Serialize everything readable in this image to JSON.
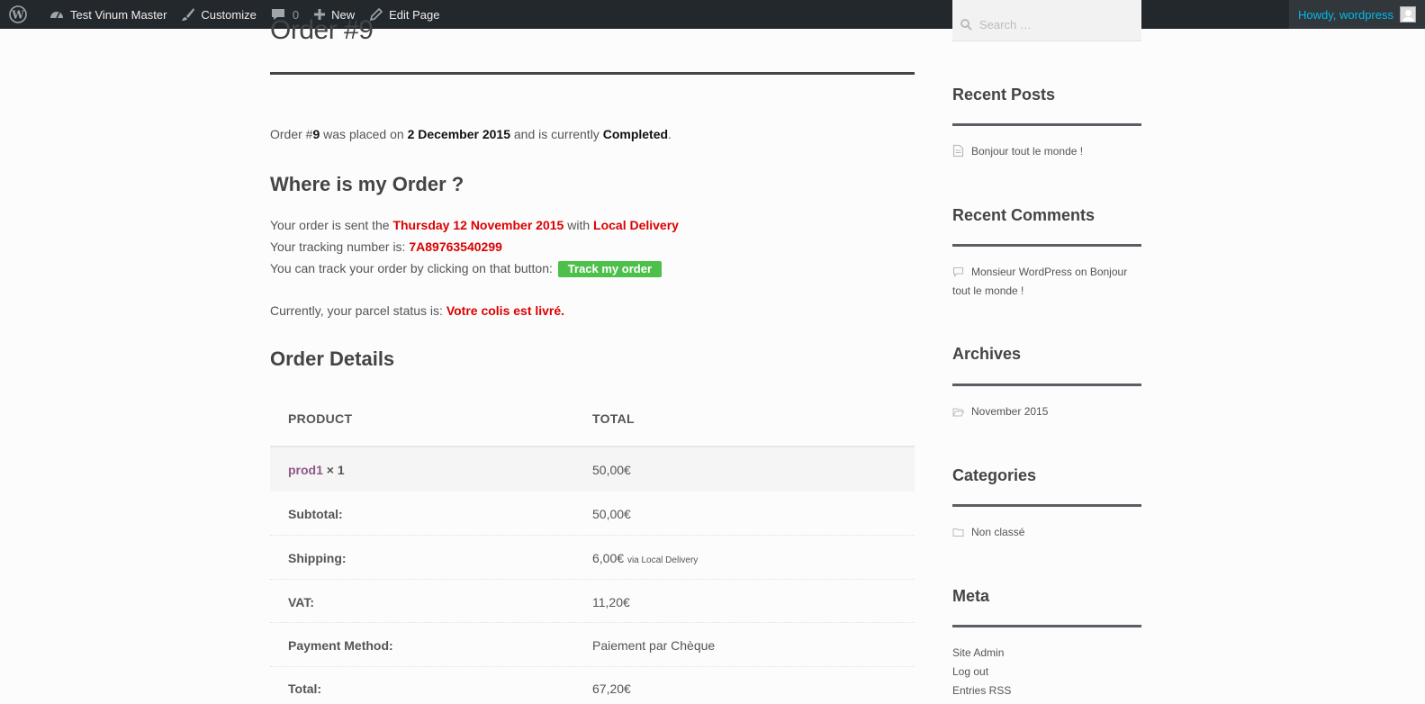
{
  "adminbar": {
    "site_name": "Test Vinum Master",
    "customize": "Customize",
    "comments_count": "0",
    "new": "New",
    "edit_page": "Edit Page",
    "howdy": "Howdy, wordpress"
  },
  "page": {
    "title": "Order #9",
    "intro": {
      "prefix": "Order #",
      "order_number": "9",
      "middle": " was placed on ",
      "date": "2 December 2015",
      "middle2": " and is currently ",
      "status": "Completed",
      "suffix": "."
    },
    "where_heading": "Where is my Order ?",
    "sent_prefix": "Your order is sent the ",
    "sent_date": "Thursday 12 November 2015",
    "sent_with": " with ",
    "delivery_method": "Local Delivery",
    "tracking_prefix": "Your tracking number is: ",
    "tracking_number": "7A89763540299",
    "track_prefix": "You can track your order by clicking on that button: ",
    "track_button": "Track my order",
    "parcel_prefix": "Currently, your parcel status is: ",
    "parcel_status": "Votre colis est livré.",
    "details_heading": "Order Details"
  },
  "order_table": {
    "headers": [
      "PRODUCT",
      "TOTAL"
    ],
    "product": {
      "name": "prod1",
      "qty": " × 1",
      "total": "50,00€"
    },
    "rows": [
      {
        "label": "Subtotal:",
        "value": "50,00€",
        "note": ""
      },
      {
        "label": "Shipping:",
        "value": "6,00€",
        "note": "via Local Delivery"
      },
      {
        "label": "VAT:",
        "value": "11,20€",
        "note": ""
      },
      {
        "label": "Payment Method:",
        "value": "Paiement par Chèque",
        "note": ""
      },
      {
        "label": "Total:",
        "value": "67,20€",
        "note": ""
      }
    ]
  },
  "sidebar": {
    "search_placeholder": "Search …",
    "recent_posts": {
      "title": "Recent Posts",
      "items": [
        "Bonjour tout le monde !"
      ]
    },
    "recent_comments": {
      "title": "Recent Comments",
      "line1": "Monsieur WordPress on Bonjour",
      "line2": "tout le monde !"
    },
    "archives": {
      "title": "Archives",
      "items": [
        "November 2015"
      ]
    },
    "categories": {
      "title": "Categories",
      "items": [
        "Non classé"
      ]
    },
    "meta": {
      "title": "Meta",
      "items": [
        "Site Admin",
        "Log out",
        "Entries RSS"
      ]
    }
  }
}
